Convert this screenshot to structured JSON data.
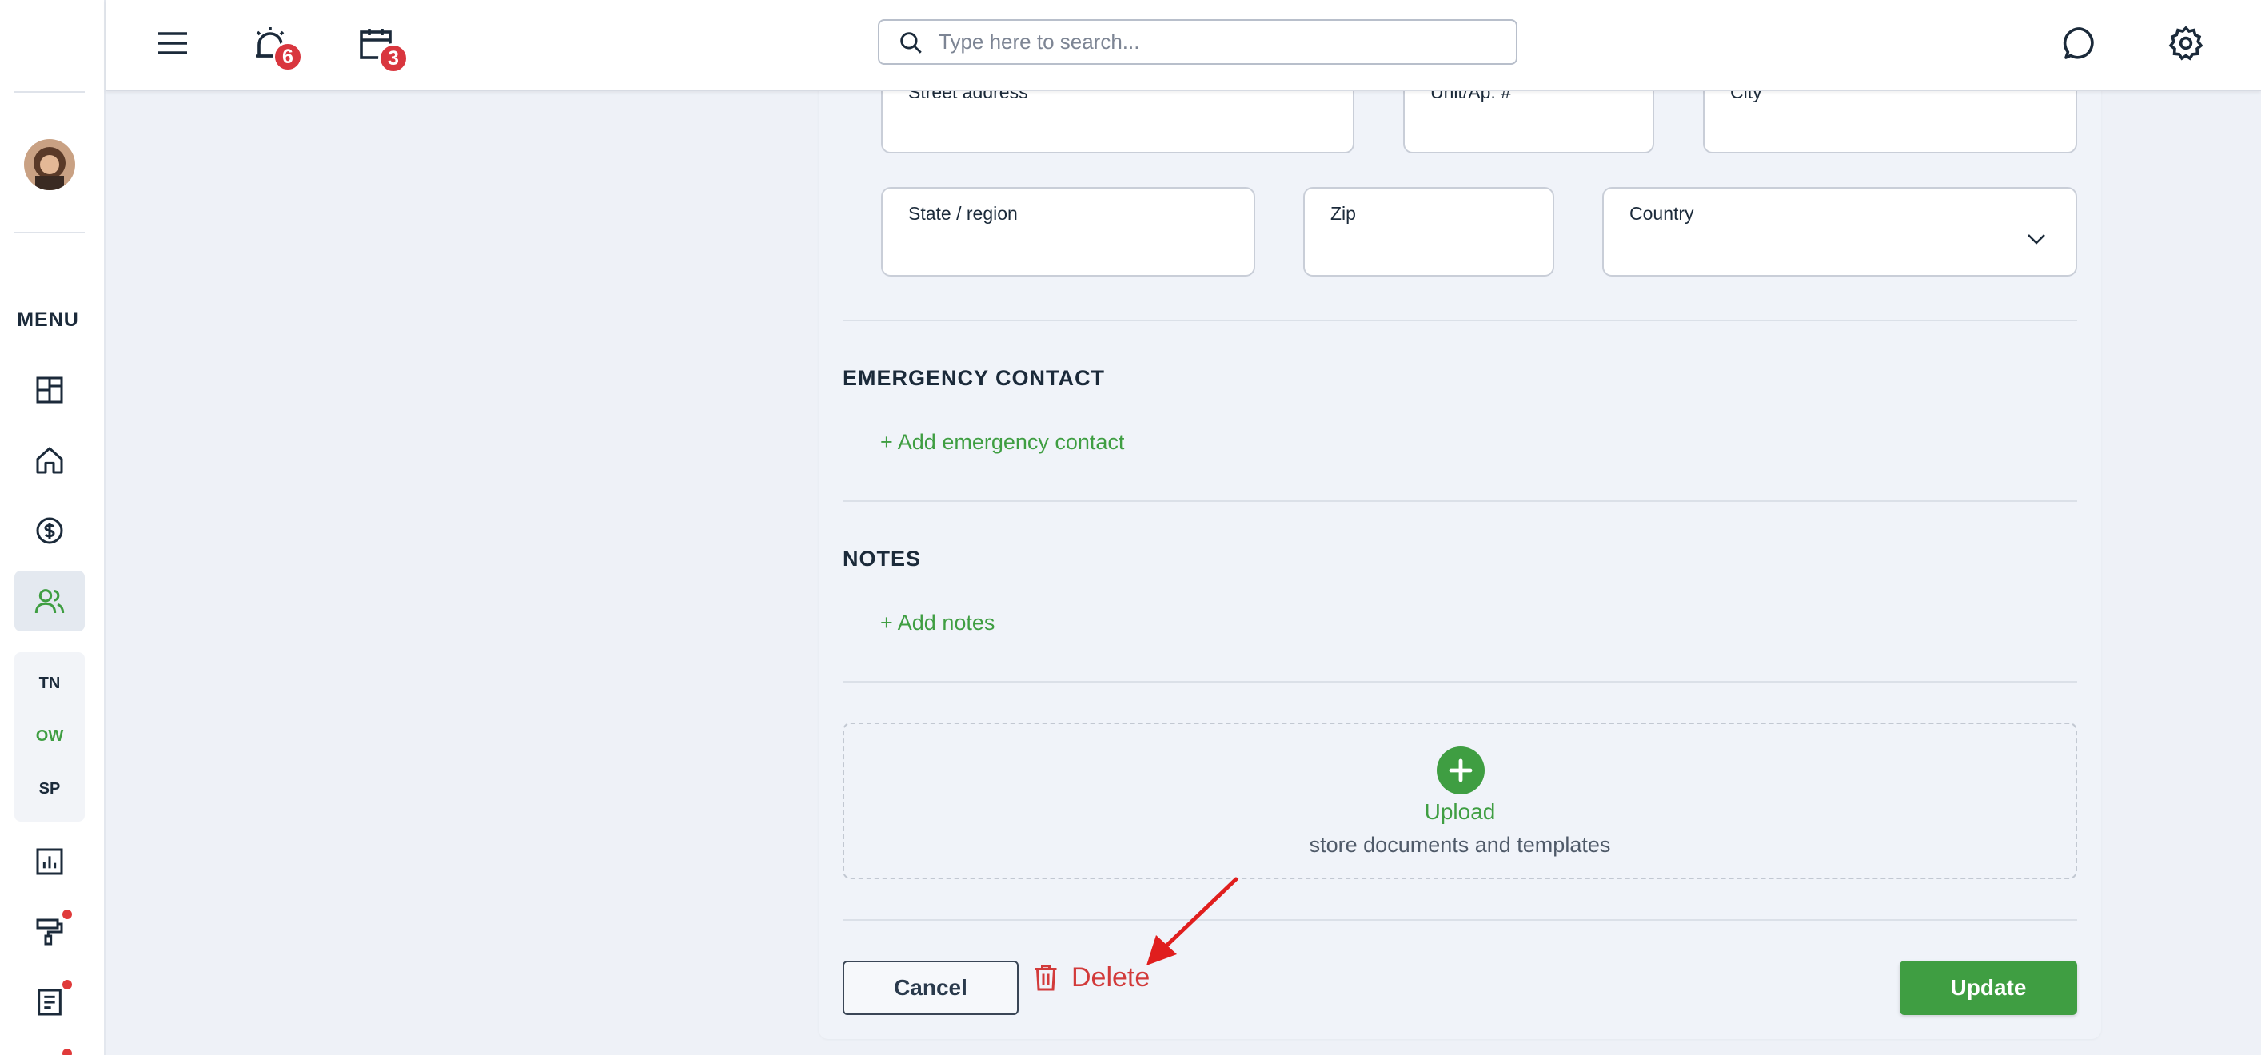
{
  "topbar": {
    "alerts_count": "6",
    "calendar_count": "3",
    "search_placeholder": "Type here to search..."
  },
  "sidebar": {
    "menu_label": "MENU",
    "quick_links": [
      "TN",
      "OW",
      "SP"
    ]
  },
  "form": {
    "address_fields": {
      "street_label": "Street address",
      "unit_label": "Unit/Ap. #",
      "city_label": "City",
      "state_label": "State / region",
      "zip_label": "Zip",
      "country_label": "Country"
    },
    "emergency": {
      "title": "EMERGENCY CONTACT",
      "add_label": "+ Add emergency contact"
    },
    "notes": {
      "title": "NOTES",
      "add_label": "+ Add notes"
    },
    "upload": {
      "title": "Upload",
      "subtitle": "store documents and templates"
    },
    "actions": {
      "cancel_label": "Cancel",
      "delete_label": "Delete",
      "update_label": "Update"
    }
  },
  "colors": {
    "accent_green": "#3f9e42",
    "danger_red": "#d23a3a",
    "badge_red": "#d9363e"
  }
}
